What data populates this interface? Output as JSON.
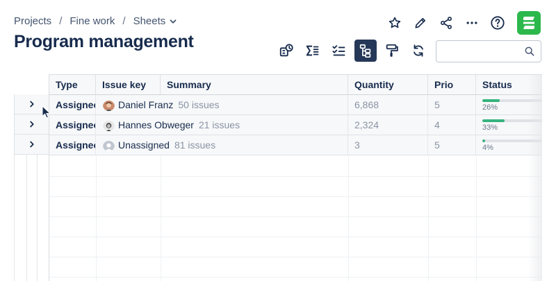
{
  "breadcrumb": {
    "items": [
      "Projects",
      "Fine work",
      "Sheets"
    ],
    "separator": "/"
  },
  "page_title": "Program management",
  "top_actions": [
    "star-icon",
    "pencil-icon",
    "share-icon",
    "more-icon",
    "help-icon"
  ],
  "toolbar": {
    "buttons": [
      "summary-clock-icon",
      "sigma-icon",
      "checklist-icon",
      "hierarchy-icon",
      "paint-roller-icon",
      "refresh-icon"
    ],
    "active": "hierarchy-icon"
  },
  "search": {
    "placeholder": "",
    "value": ""
  },
  "table": {
    "columns": [
      "Type",
      "Issue key",
      "Summary",
      "Quantity",
      "Prio",
      "Status"
    ],
    "rows": [
      {
        "type": "Assignee",
        "name": "Daniel Franz",
        "count": "50 issues",
        "quantity": "6,868",
        "prio": "5",
        "status_pct": "26%",
        "status_value": 0.26
      },
      {
        "type": "Assignee",
        "name": "Hannes Obweger",
        "count": "21 issues",
        "quantity": "2,324",
        "prio": "4",
        "status_pct": "33%",
        "status_value": 0.33
      },
      {
        "type": "Assignee",
        "name": "Unassigned",
        "count": "81 issues",
        "quantity": "3",
        "prio": "5",
        "status_pct": "4%",
        "status_value": 0.04
      }
    ]
  },
  "colors": {
    "accent_active": "#253858",
    "status_green": "#36b37e",
    "logo_green": "#2db84c"
  }
}
